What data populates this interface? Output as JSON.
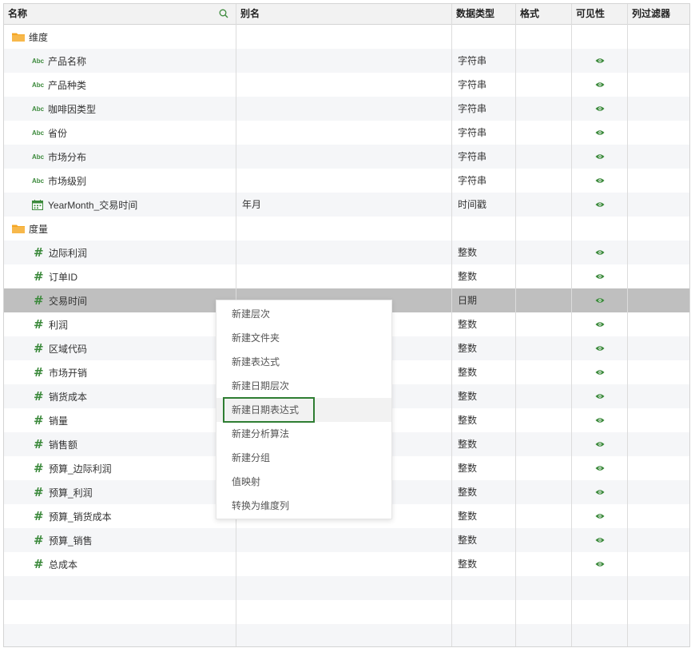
{
  "header": {
    "name": "名称",
    "alias": "别名",
    "datatype": "数据类型",
    "format": "格式",
    "visible": "可见性",
    "column_filter": "列过滤器"
  },
  "folders": {
    "dimension": "维度",
    "measure": "度量"
  },
  "dimension_items": [
    {
      "icon": "Abc",
      "name": "产品名称",
      "alias": "",
      "type": "字符串"
    },
    {
      "icon": "Abc",
      "name": "产品种类",
      "alias": "",
      "type": "字符串"
    },
    {
      "icon": "Abc",
      "name": "咖啡因类型",
      "alias": "",
      "type": "字符串"
    },
    {
      "icon": "Abc",
      "name": "省份",
      "alias": "",
      "type": "字符串"
    },
    {
      "icon": "Abc",
      "name": "市场分布",
      "alias": "",
      "type": "字符串"
    },
    {
      "icon": "Abc",
      "name": "市场级别",
      "alias": "",
      "type": "字符串"
    },
    {
      "icon": "calendar",
      "name": "YearMonth_交易时间",
      "alias": "年月",
      "type": "时间戳"
    }
  ],
  "measure_items": [
    {
      "name": "边际利润",
      "type": "整数"
    },
    {
      "name": "订单ID",
      "type": "整数"
    },
    {
      "name": "交易时间",
      "type": "日期"
    },
    {
      "name": "利润",
      "type": "整数"
    },
    {
      "name": "区域代码",
      "type": "整数"
    },
    {
      "name": "市场开销",
      "type": "整数"
    },
    {
      "name": "销货成本",
      "type": "整数"
    },
    {
      "name": "销量",
      "type": "整数"
    },
    {
      "name": "销售额",
      "type": "整数"
    },
    {
      "name": "预算_边际利润",
      "type": "整数"
    },
    {
      "name": "预算_利润",
      "type": "整数"
    },
    {
      "name": "预算_销货成本",
      "type": "整数"
    },
    {
      "name": "预算_销售",
      "type": "整数"
    },
    {
      "name": "总成本",
      "type": "整数"
    }
  ],
  "hash_symbol": "#",
  "context_menu": {
    "items": [
      "新建层次",
      "新建文件夹",
      "新建表达式",
      "新建日期层次",
      "新建日期表达式",
      "新建分析算法",
      "新建分组",
      "值映射",
      "转换为维度列"
    ],
    "highlighted": "新建日期表达式"
  },
  "colors": {
    "accent_green": "#3c8a3c",
    "selected_row": "#bfbfbf",
    "highlight_box": "#2e7d32",
    "folder": "#f5a623"
  }
}
